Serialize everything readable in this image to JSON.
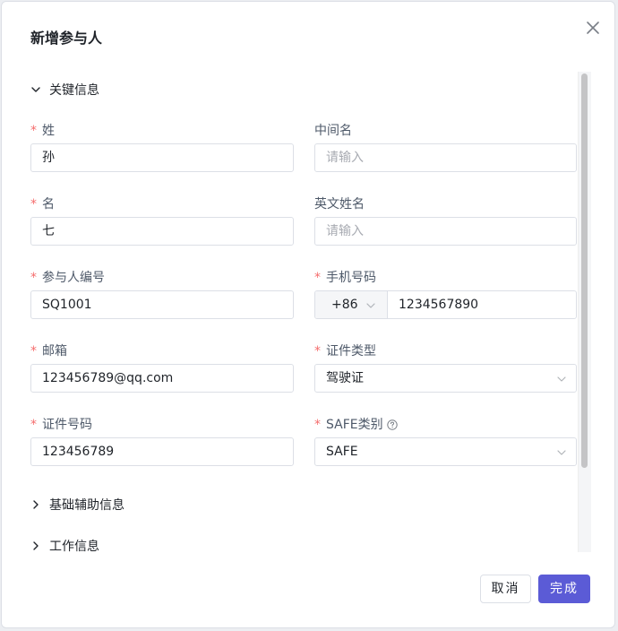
{
  "dialog": {
    "title": "新增参与人"
  },
  "sections": {
    "key_info": "关键信息",
    "basic_aux": "基础辅助信息",
    "work_info": "工作信息"
  },
  "form": {
    "surname": {
      "label": "姓",
      "value": "孙",
      "required": true
    },
    "middle_name": {
      "label": "中间名",
      "placeholder": "请输入",
      "required": false
    },
    "given_name": {
      "label": "名",
      "value": "七",
      "required": true
    },
    "english_name": {
      "label": "英文姓名",
      "placeholder": "请输入",
      "required": false
    },
    "participant_no": {
      "label": "参与人编号",
      "value": "SQ1001",
      "required": true
    },
    "phone": {
      "label": "手机号码",
      "country_code": "+86",
      "value": "1234567890",
      "required": true
    },
    "email": {
      "label": "邮箱",
      "value": "123456789@qq.com",
      "required": true
    },
    "id_type": {
      "label": "证件类型",
      "value": "驾驶证",
      "required": true
    },
    "id_number": {
      "label": "证件号码",
      "value": "123456789",
      "required": true
    },
    "safe_type": {
      "label": "SAFE类别",
      "value": "SAFE",
      "required": true
    }
  },
  "required_mark": "*",
  "footer": {
    "cancel_label": "取消",
    "ok_label": "完成"
  },
  "colors": {
    "primary": "#5b5bd6",
    "required": "#f56c6c",
    "border": "#dcdfe6"
  }
}
